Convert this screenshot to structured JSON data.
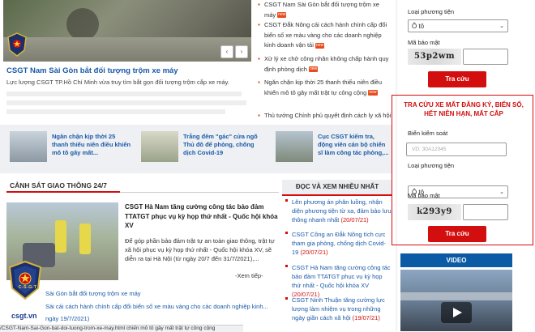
{
  "hero": {
    "title": "CSGT Nam Sài Gòn bắt đối tượng trộm xe máy",
    "desc": "Lực lượng CSGT TP.Hồ Chí Minh vừa truy tìm bắt gọn đối tượng trộm cắp xe máy.",
    "prev": "‹",
    "next": "›"
  },
  "top_news": [
    {
      "text": "CSGT Nam Sài Gòn bắt đối tượng trộm xe máy",
      "badge": "new"
    },
    {
      "text": "CSGT Đắk Nông cải cách hành chính cấp đổi biển số xe màu vàng cho các doanh nghiệp kinh doanh vận tải",
      "badge": "new"
    },
    {
      "text": "Xử lý xe chở công nhân không chấp hành quy định phòng dịch",
      "badge": "new"
    },
    {
      "text": "Ngăn chặn kịp thời 25 thanh thiếu niên điều khiển mô tô gây mất trật tự công cộng",
      "badge": "new"
    },
    {
      "text": "Thủ tướng Chính phủ quyết định cách ly xã hội"
    }
  ],
  "strip": [
    {
      "title": "Ngăn chặn kịp thời 25 thanh thiếu niên điều khiển mô tô gây mất..."
    },
    {
      "title": "Trắng đêm \"gác\" cửa ngõ Thủ đô để phòng, chống dịch Covid-19"
    },
    {
      "title": "Cục CSGT kiểm tra, động viên cán bộ chiến sĩ làm công tác phòng,..."
    }
  ],
  "section": {
    "main": "CẢNH SÁT GIAO THÔNG 24/7",
    "side": "ĐỌC VÀ XEM NHIỀU NHẤT"
  },
  "article": {
    "title": "CSGT Hà Nam tăng cường công tác bảo đảm TTATGT phục vụ kỳ họp thứ nhất - Quốc hội khóa XV",
    "desc": "Để góp phần bảo đảm trật tự an toàn giao thông, trật tự xã hội phục vụ kỳ họp thứ nhất - Quốc hội khóa XV, sẽ diễn ra tại Hà Nội (từ ngày 20/7 đến 31/7/2021),...",
    "more": "-Xem tiếp-"
  },
  "bottom_list": [
    "Sài Gòn bắt đối tượng trộm xe máy",
    "Sài cải cách hành chính cấp đổi biển số xe màu vàng cho các doanh nghiệp kinh...",
    "ngày 19/7/2021)"
  ],
  "most_read": [
    {
      "text": "Lên phương án phân luồng, nhận diện phương tiện từ xa, đảm bảo lưu thông nhanh nhất",
      "date": "(20/07/21)"
    },
    {
      "text": "CSGT Công an Đắk Nông tích cực tham gia phòng, chống dịch Covid-19",
      "date": "(20/07/21)"
    },
    {
      "text": "CSGT Hà Nam tăng cường công tác bảo đảm TTATGT phục vụ kỳ họp thứ nhất - Quốc hội khóa XV",
      "date": "(20/07/21)"
    },
    {
      "text": "CSGT Ninh Thuận tăng cường lực lượng làm nhiệm vụ trong những ngày giãn cách xã hội",
      "date": "(19/07/21)"
    }
  ],
  "form1": {
    "vehicle_label": "Loại phương tiện",
    "vehicle_value": "Ô tô",
    "captcha_label": "Mã bảo mật",
    "captcha": "53p2wm",
    "submit": "Tra cứu"
  },
  "form2": {
    "title": "TRA CỨU XE MẤT ĐĂNG KÝ, BIỂN SỐ, HẾT NIÊN HẠN, MẤT CẮP",
    "plate_label": "Biển kiểm soát",
    "plate_placeholder": "VD: 30A12345",
    "vehicle_label": "Loại phương tiện",
    "vehicle_value": "Ô tô",
    "captcha_label": "Mã bảo mật",
    "captcha": "k293y9",
    "submit": "Tra cứu"
  },
  "video": {
    "header": "VIDEO"
  },
  "logo": {
    "text": "C-S-G-T",
    "site": "csgt.vn"
  },
  "status_bar": "/CSGT-Nam-Sai-Gon-bat-doi-tuong-trom-xe-may.html  chiến mô tô gây mất trật tự công cộng",
  "colors": {
    "accent_blue": "#1a5aa8",
    "accent_red": "#d20e0e",
    "header_blue": "#0b5aa5"
  }
}
